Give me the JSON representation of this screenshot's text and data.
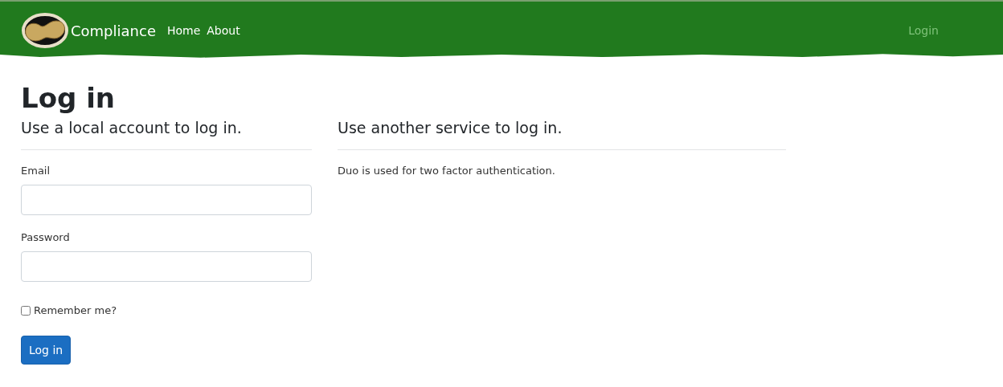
{
  "navbar": {
    "brand": "Compliance",
    "links": [
      {
        "label": "Home"
      },
      {
        "label": "About"
      }
    ],
    "login_link": "Login"
  },
  "page": {
    "title": "Log in"
  },
  "local": {
    "heading": "Use a local account to log in.",
    "fields": [
      {
        "label": "Email"
      },
      {
        "label": "Password"
      }
    ],
    "remember": {
      "label": "Remember me?",
      "checked": false
    },
    "submit": "Log in"
  },
  "external": {
    "heading": "Use another service to log in.",
    "note": "Duo is used for two factor authentication."
  }
}
